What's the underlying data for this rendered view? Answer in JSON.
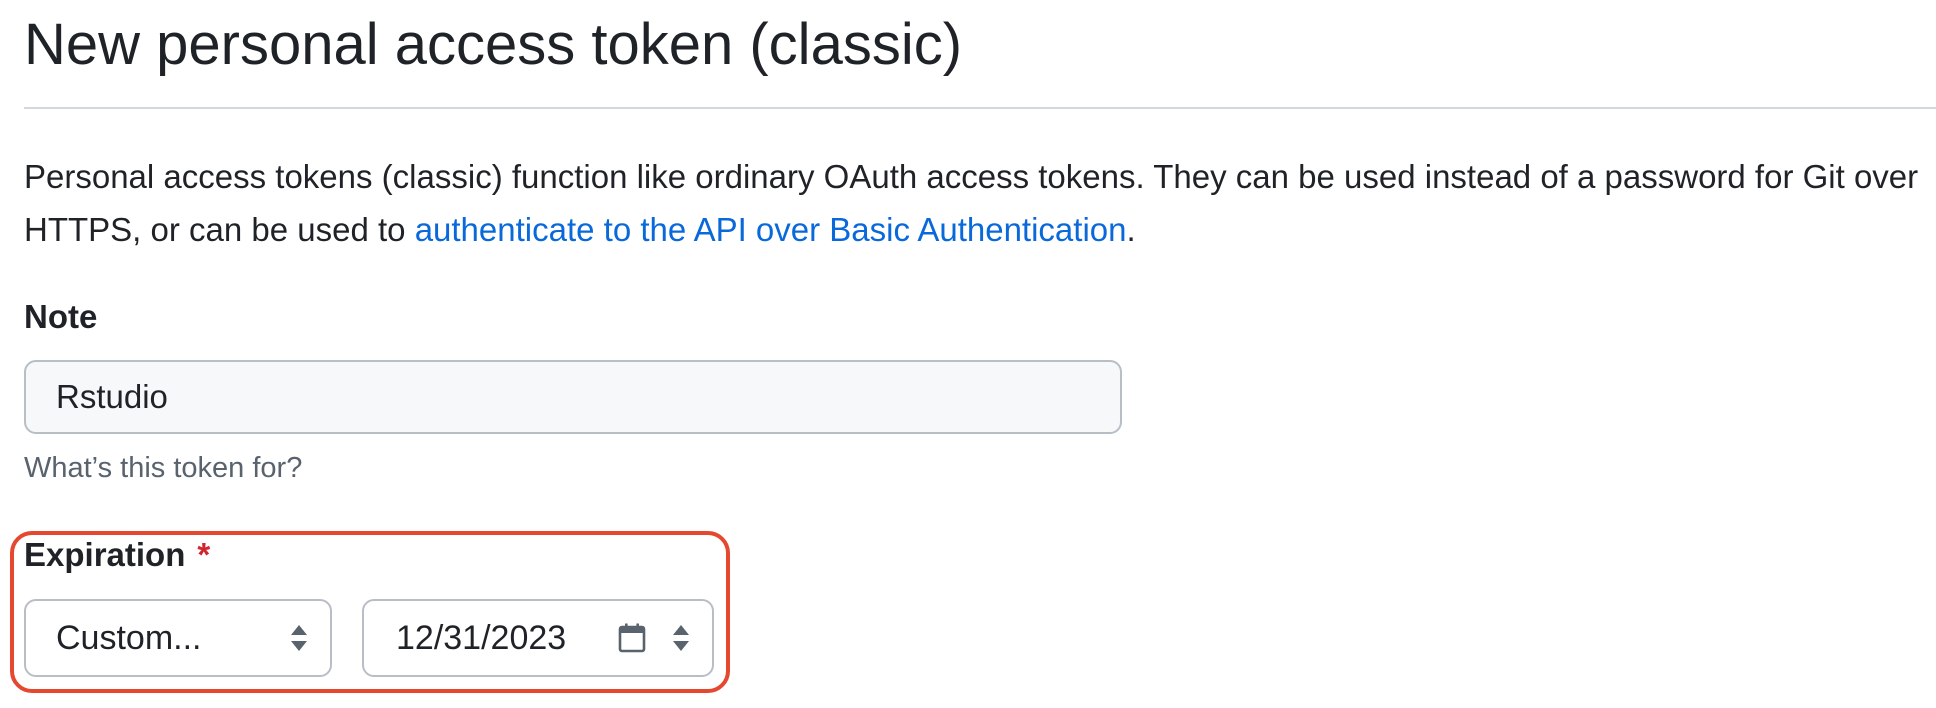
{
  "page": {
    "title": "New personal access token (classic)"
  },
  "intro": {
    "text_before": "Personal access tokens (classic) function like ordinary OAuth access tokens. They can be used instead of a password for Git over HTTPS, or can be used to ",
    "link_text": "authenticate to the API over Basic Authentication",
    "text_after": "."
  },
  "note": {
    "label": "Note",
    "value": "Rstudio",
    "hint": "What’s this token for?"
  },
  "expiration": {
    "label": "Expiration",
    "required_marker": "*",
    "select_value": "Custom...",
    "date_value": "12/31/2023"
  },
  "colors": {
    "link": "#0969da",
    "required": "#d1242f",
    "highlight": "#e5482f"
  },
  "icons": {
    "select_arrows": "chevron-updown-icon",
    "calendar": "calendar-icon",
    "date_arrows": "chevron-updown-icon"
  }
}
